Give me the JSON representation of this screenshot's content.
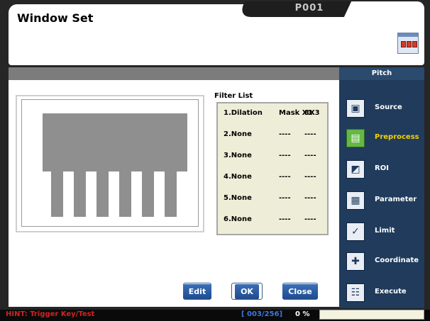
{
  "header": {
    "window_title": "Window Set",
    "code": "P001"
  },
  "section": {
    "label": "Pitch"
  },
  "filter_list": {
    "title": "Filter List",
    "rows": [
      {
        "name": "1.Dilation",
        "v1": "Mask X1",
        "v2": "3X3"
      },
      {
        "name": "2.None",
        "v1": "----",
        "v2": "----"
      },
      {
        "name": "3.None",
        "v1": "----",
        "v2": "----"
      },
      {
        "name": "4.None",
        "v1": "----",
        "v2": "----"
      },
      {
        "name": "5.None",
        "v1": "----",
        "v2": "----"
      },
      {
        "name": "6.None",
        "v1": "----",
        "v2": "----"
      }
    ]
  },
  "buttons": {
    "edit": "Edit",
    "ok": "OK",
    "close": "Close"
  },
  "nav": {
    "items": [
      {
        "label": "Source",
        "icon": "source-icon"
      },
      {
        "label": "Preprocess",
        "icon": "preprocess-icon",
        "active": true
      },
      {
        "label": "ROI",
        "icon": "roi-icon"
      },
      {
        "label": "Parameter",
        "icon": "parameter-icon"
      },
      {
        "label": "Limit",
        "icon": "limit-icon"
      },
      {
        "label": "Coordinate",
        "icon": "coordinate-icon"
      },
      {
        "label": "Execute",
        "icon": "execute-icon"
      }
    ]
  },
  "status": {
    "hint": "HINT: Trigger Key/Test",
    "counter": "[ 003/256]",
    "percent": "0 %"
  },
  "colors": {
    "accent": "#203b5c",
    "active_icon": "#65b845",
    "active_text": "#f5d000",
    "hint_text": "#d02424"
  }
}
